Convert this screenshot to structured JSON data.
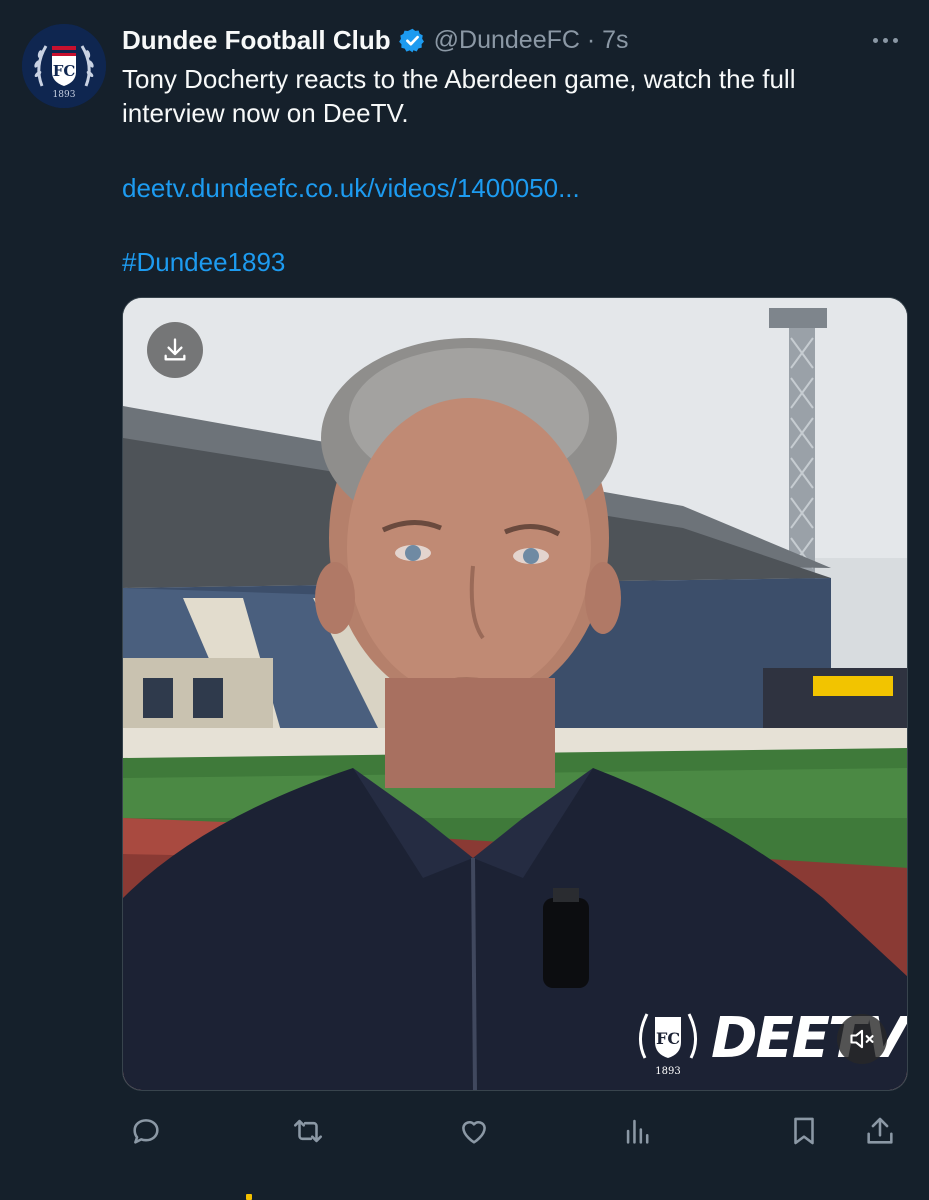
{
  "tweet": {
    "author_name": "Dundee Football Club",
    "handle_time": "@DundeeFC · 7s",
    "text": "Tony Docherty reacts to the Aberdeen game, watch the full interview now on DeeTV.",
    "link": "deetv.dundeefc.co.uk/videos/1400050...",
    "hashtag": "#Dundee1893"
  },
  "media": {
    "watermark_text": "DEETV",
    "logo_year": "1893"
  },
  "icons": {
    "avatar": "club-crest-avatar",
    "verified": "verified-badge-icon",
    "more": "more-options-icon",
    "download": "download-icon",
    "mute": "muted-speaker-icon",
    "reply": "reply-icon",
    "retweet": "retweet-icon",
    "like": "like-icon",
    "views": "views-icon",
    "bookmark": "bookmark-icon",
    "share": "share-icon"
  },
  "colors": {
    "background": "#15202b",
    "accent": "#1d9bf0",
    "secondary_text": "#8b98a5",
    "club_navy": "#0f2650"
  }
}
